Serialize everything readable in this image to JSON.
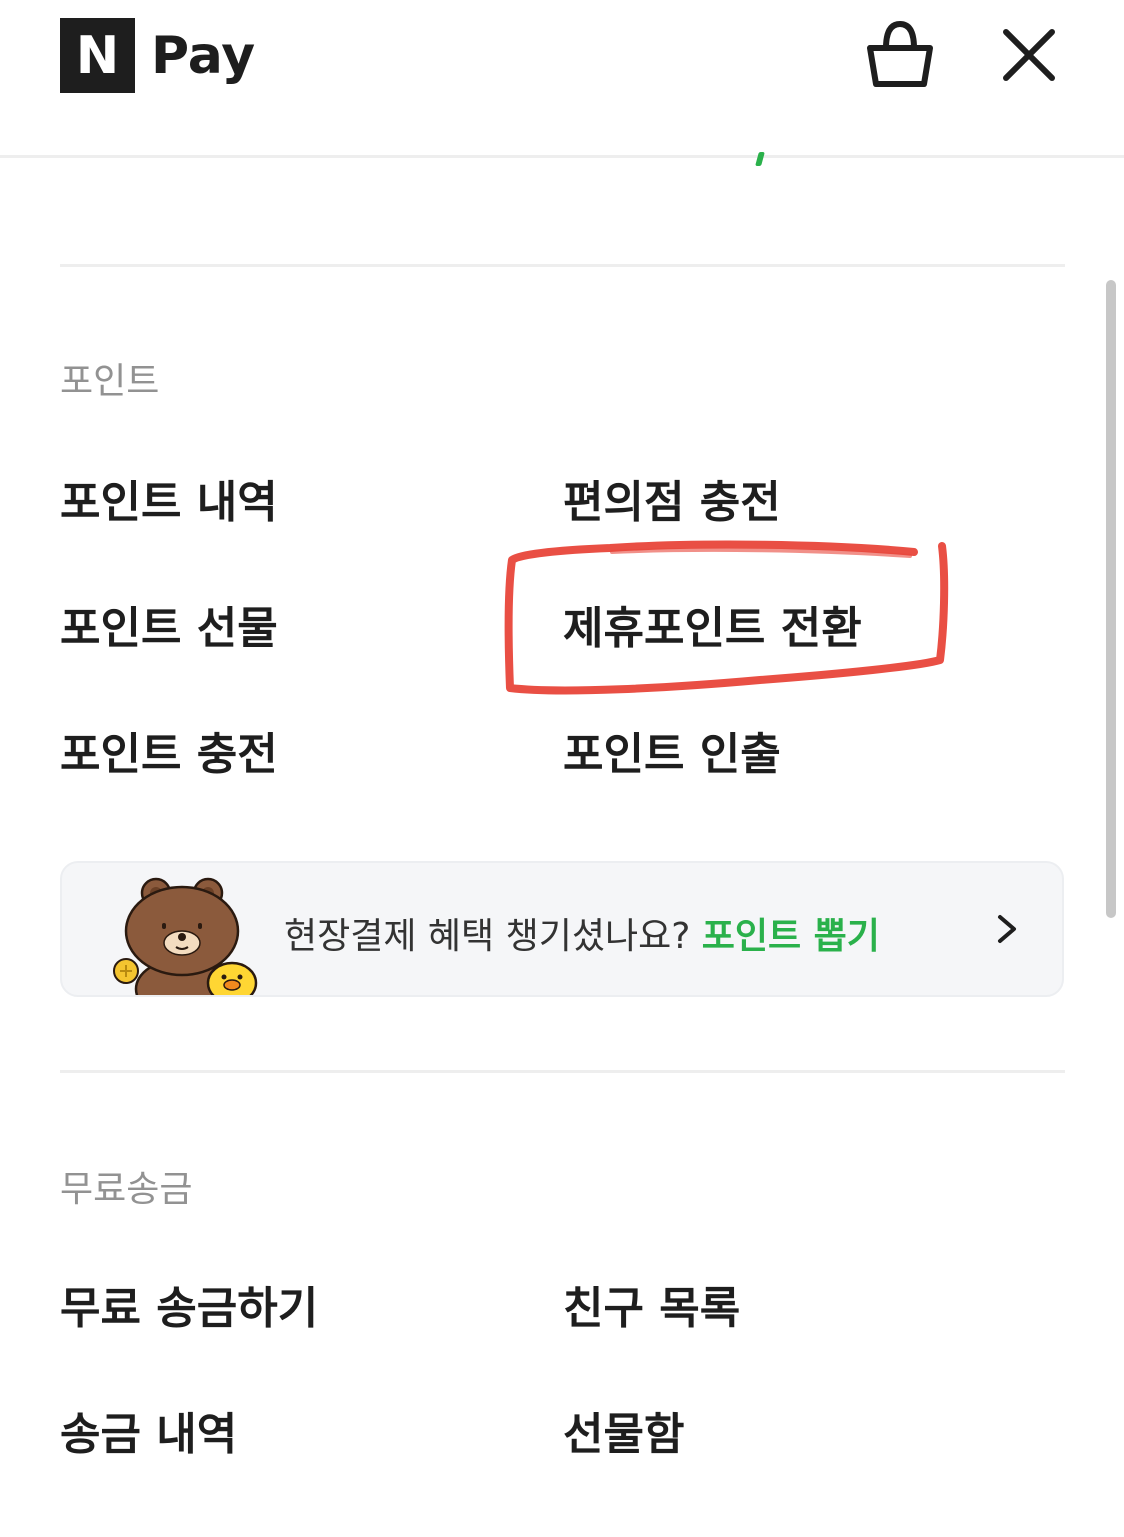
{
  "header": {
    "logo_mark": "N",
    "logo_text": "Pay",
    "cart_icon": "shopping-bag-icon",
    "close_icon": "close-icon"
  },
  "points": {
    "section_title": "포인트",
    "items": [
      {
        "label": "포인트 내역"
      },
      {
        "label": "편의점 충전"
      },
      {
        "label": "포인트 선물"
      },
      {
        "label": "제휴포인트 전환"
      },
      {
        "label": "포인트 충전"
      },
      {
        "label": "포인트 인출"
      }
    ],
    "highlighted_item": "제휴포인트 전환"
  },
  "banner": {
    "text": "현장결제 혜택 챙기셨나요? ",
    "link_text": "포인트 뽑기",
    "illustration": "brown-bear-and-sally-chick",
    "chevron_icon": "chevron-right-icon"
  },
  "free_transfer": {
    "section_title": "무료송금",
    "items": [
      {
        "label": "무료 송금하기"
      },
      {
        "label": "친구 목록"
      },
      {
        "label": "송금 내역"
      },
      {
        "label": "선물함"
      }
    ]
  },
  "colors": {
    "accent_green": "#2ab14b",
    "annotation_red": "#e8463a",
    "text_dark": "#1e1e1e",
    "text_muted": "#929292"
  }
}
